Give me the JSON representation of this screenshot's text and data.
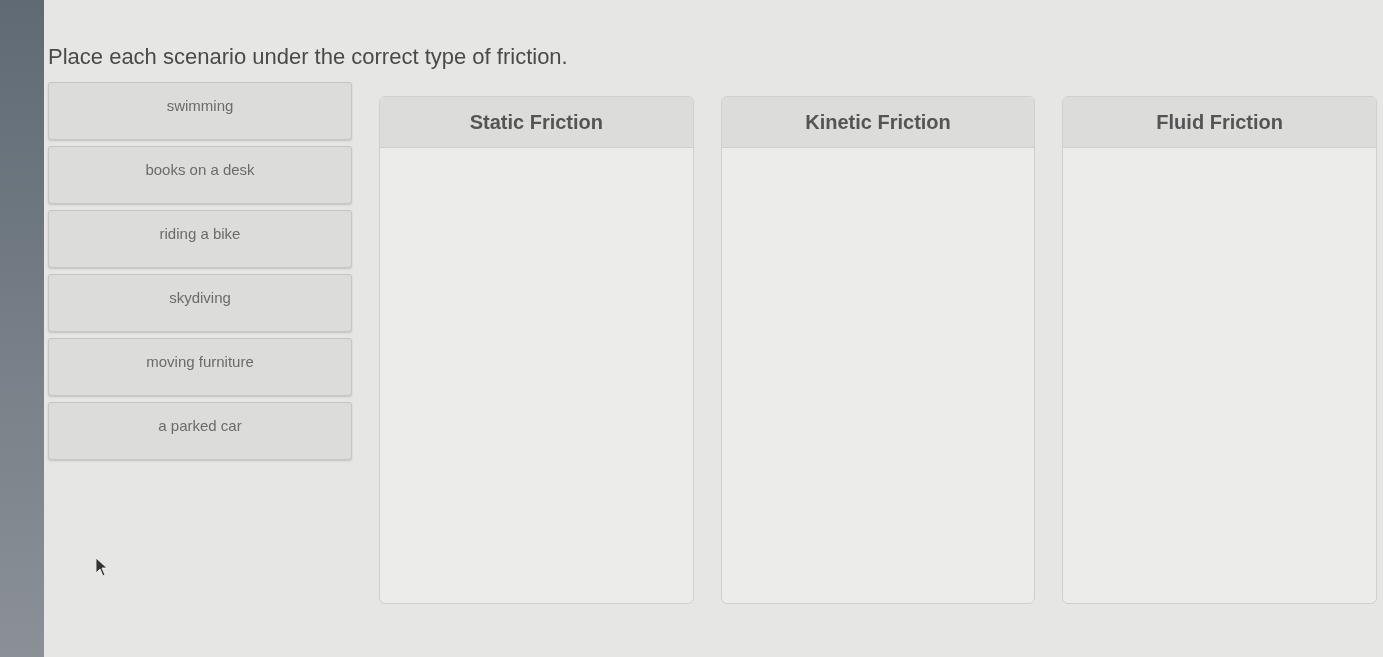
{
  "instruction": "Place each scenario under the correct type of friction.",
  "scenarios": [
    "swimming",
    "books on a desk",
    "riding a bike",
    "skydiving",
    "moving furniture",
    "a parked car"
  ],
  "categories": [
    {
      "label": "Static Friction"
    },
    {
      "label": "Kinetic Friction"
    },
    {
      "label": "Fluid Friction"
    }
  ]
}
